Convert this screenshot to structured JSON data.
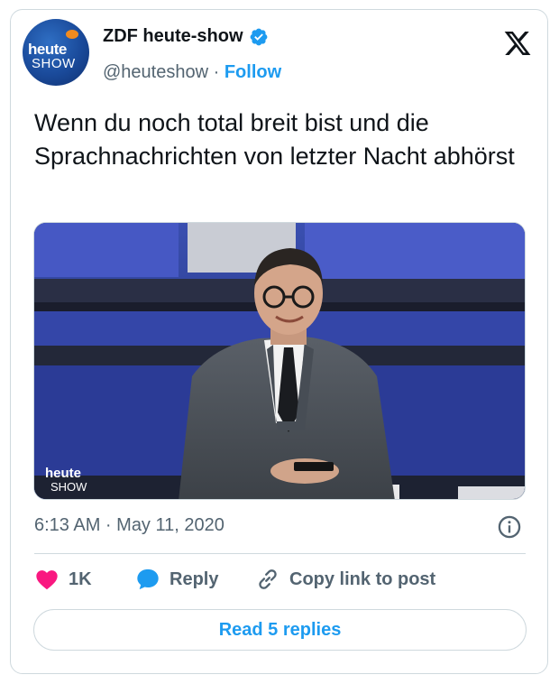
{
  "account": {
    "display_name": "ZDF heute-show",
    "handle": "@heuteshow",
    "separator": " · ",
    "follow_label": "Follow",
    "avatar_text_top": "heute",
    "avatar_text_bottom": "SHOW"
  },
  "tweet": {
    "text": "Wenn du noch total breit bist und die Sprachnachrichten von letzter Nacht abhörst",
    "timestamp": "6:13 AM · May 11, 2020",
    "media_watermark_top": "heute",
    "media_watermark_bottom": "SHOW"
  },
  "actions": {
    "like_count": "1K",
    "reply_label": "Reply",
    "copy_label": "Copy link to post"
  },
  "footer": {
    "read_replies_label": "Read 5 replies"
  },
  "colors": {
    "accent": "#1d9bf0",
    "like": "#f91880",
    "muted": "#536471",
    "border": "#cfd9de"
  },
  "icons": [
    "verified-badge-icon",
    "x-logo-icon",
    "info-icon",
    "heart-icon",
    "reply-bubble-icon",
    "link-icon"
  ]
}
